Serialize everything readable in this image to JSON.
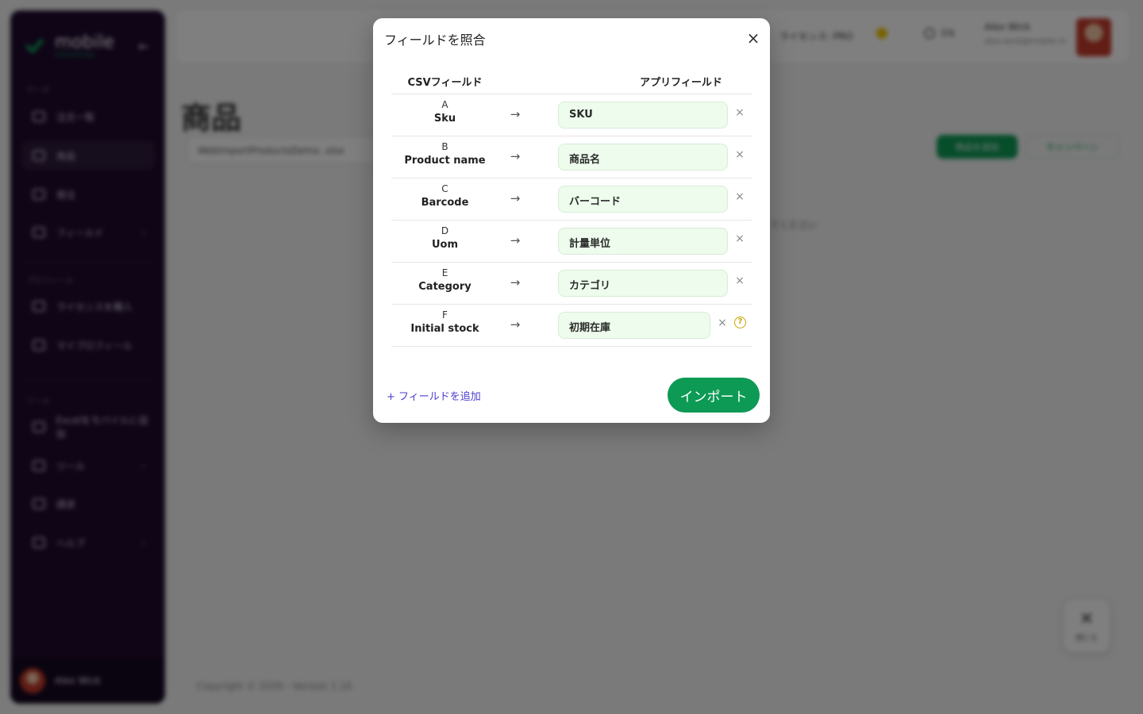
{
  "background": {
    "sidebar": {
      "logo": "mobile",
      "logo_sub": "ORDERING",
      "section_labels": [
        "データ",
        "プロフィール",
        "ツール"
      ],
      "items": [
        {
          "label": "注文一覧",
          "active": false
        },
        {
          "label": "商品",
          "active": true
        },
        {
          "label": "発注",
          "active": false
        },
        {
          "label": "フィールド",
          "active": false
        },
        {
          "label": "ライセンスを購入",
          "active": false
        },
        {
          "label": "マイプロフィール",
          "active": false
        },
        {
          "label": "Excelをモバイルに追加",
          "active": false
        },
        {
          "label": "ツール",
          "active": false
        },
        {
          "label": "請求",
          "active": false
        },
        {
          "label": "ヘルプ",
          "active": false
        }
      ],
      "user_name": "Alex Wick"
    },
    "topbar": {
      "license": "ライセンス: PRO",
      "language": "EN",
      "user_name": "Alex Wick",
      "user_email": "alex-wick@mobile.io"
    },
    "page_title": "商品",
    "file_name": "WebImportProductsDemo .xlsx",
    "add_button": "商品を追加",
    "link_button": "キャンペーン",
    "hint": "てください",
    "footer": "Copyright © 2026 - Version 1.10",
    "fab_label": "閉じる"
  },
  "modal": {
    "title": "フィールドを照合",
    "close_icon": "×",
    "header_csv": "CSVフィールド",
    "header_app": "アプリフィールド",
    "arrow": "→",
    "remove_icon": "×",
    "help_icon": "?",
    "rows": [
      {
        "letter": "A",
        "csv": "Sku",
        "app": "SKU",
        "help": false
      },
      {
        "letter": "B",
        "csv": "Product name",
        "app": "商品名",
        "help": false
      },
      {
        "letter": "C",
        "csv": "Barcode",
        "app": "バーコード",
        "help": false
      },
      {
        "letter": "D",
        "csv": "Uom",
        "app": "計量単位",
        "help": false
      },
      {
        "letter": "E",
        "csv": "Category",
        "app": "カテゴリ",
        "help": false
      },
      {
        "letter": "F",
        "csv": "Initial stock",
        "app": "初期在庫",
        "help": true
      }
    ],
    "add_field": "+ フィールドを追加",
    "import_button": "インポート"
  },
  "colors": {
    "brand_green": "#0d9a55",
    "field_bg": "#edfcec",
    "link_purple": "#4a3fd0",
    "help_yellow": "#c8a500",
    "sidebar_bg": "#1f0a2e"
  }
}
